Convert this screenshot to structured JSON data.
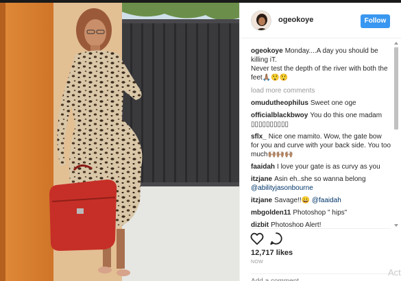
{
  "post": {
    "username": "ogeokoye",
    "follow_label": "Follow",
    "caption_user": "ogeokoye",
    "caption_text": "Monday....A day you should be killing iT.\nNever test the depth of the river with both the feet🙏🏽😲😲",
    "load_more": "load more comments",
    "comments": [
      {
        "user": "omudutheophilus",
        "text": "Sweet one oge"
      },
      {
        "user": "officialblackbwoy",
        "text": "You do this one madam ▯▯▯▯▯▯▯▯▯▯"
      },
      {
        "user": "sflx_",
        "text": "Nice one mamito. Wow, the gate bow for you and curve with your back side. You too much🙌🏽🙌🏽🙌🏽"
      },
      {
        "user": "faaidah",
        "text": "I love your gate is as curvy as you"
      },
      {
        "user": "itzjane",
        "text": "Asin eh..she so wanna belong",
        "mention": "@abilityjasonbourne"
      },
      {
        "user": "itzjane",
        "text": "Savage!!😀",
        "mention": "@faaidah"
      },
      {
        "user": "mbgolden11",
        "text": "Photoshop \" hips\""
      },
      {
        "user": "dizbit",
        "text": "Photoshop Alert!"
      }
    ],
    "likes": "12,717 likes",
    "time": "NOW",
    "add_comment_placeholder": "Add a comment...",
    "icons": [
      "heart-icon",
      "comment-icon"
    ]
  },
  "watermark": "Act",
  "colors": {
    "follow": "#3897f0",
    "text": "#262626",
    "muted": "#999999"
  }
}
